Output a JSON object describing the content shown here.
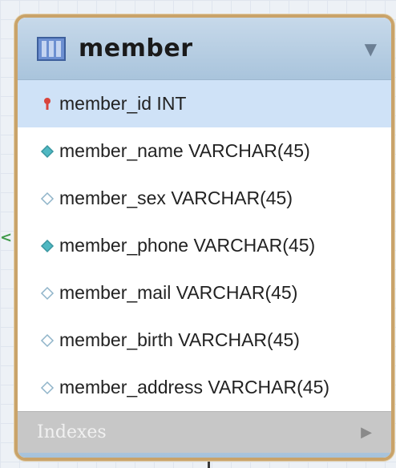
{
  "table": {
    "title": "member",
    "columns": [
      {
        "text": "member_id INT",
        "key": "primary",
        "icon": "primary-key-icon",
        "selected": true
      },
      {
        "text": "member_name VARCHAR(45)",
        "key": "not-null",
        "icon": "filled-diamond-icon",
        "selected": false
      },
      {
        "text": "member_sex VARCHAR(45)",
        "key": "nullable",
        "icon": "hollow-diamond-icon",
        "selected": false
      },
      {
        "text": "member_phone VARCHAR(45)",
        "key": "not-null",
        "icon": "filled-diamond-icon",
        "selected": false
      },
      {
        "text": "member_mail VARCHAR(45)",
        "key": "nullable",
        "icon": "hollow-diamond-icon",
        "selected": false
      },
      {
        "text": "member_birth VARCHAR(45)",
        "key": "nullable",
        "icon": "hollow-diamond-icon",
        "selected": false
      },
      {
        "text": "member_address VARCHAR(45)",
        "key": "nullable",
        "icon": "hollow-diamond-icon",
        "selected": false
      }
    ],
    "indexes_label": "Indexes"
  },
  "colors": {
    "border": "#c9a36a",
    "header": "#b8cfe4",
    "selected_row": "#cfe2f7",
    "primary_key": "#d9443c",
    "diamond_filled": "#4fb8c2",
    "diamond_hollow": "#8fb4c9",
    "indexes_bg": "#c7c7c7",
    "connector": "#3f9a4a"
  }
}
